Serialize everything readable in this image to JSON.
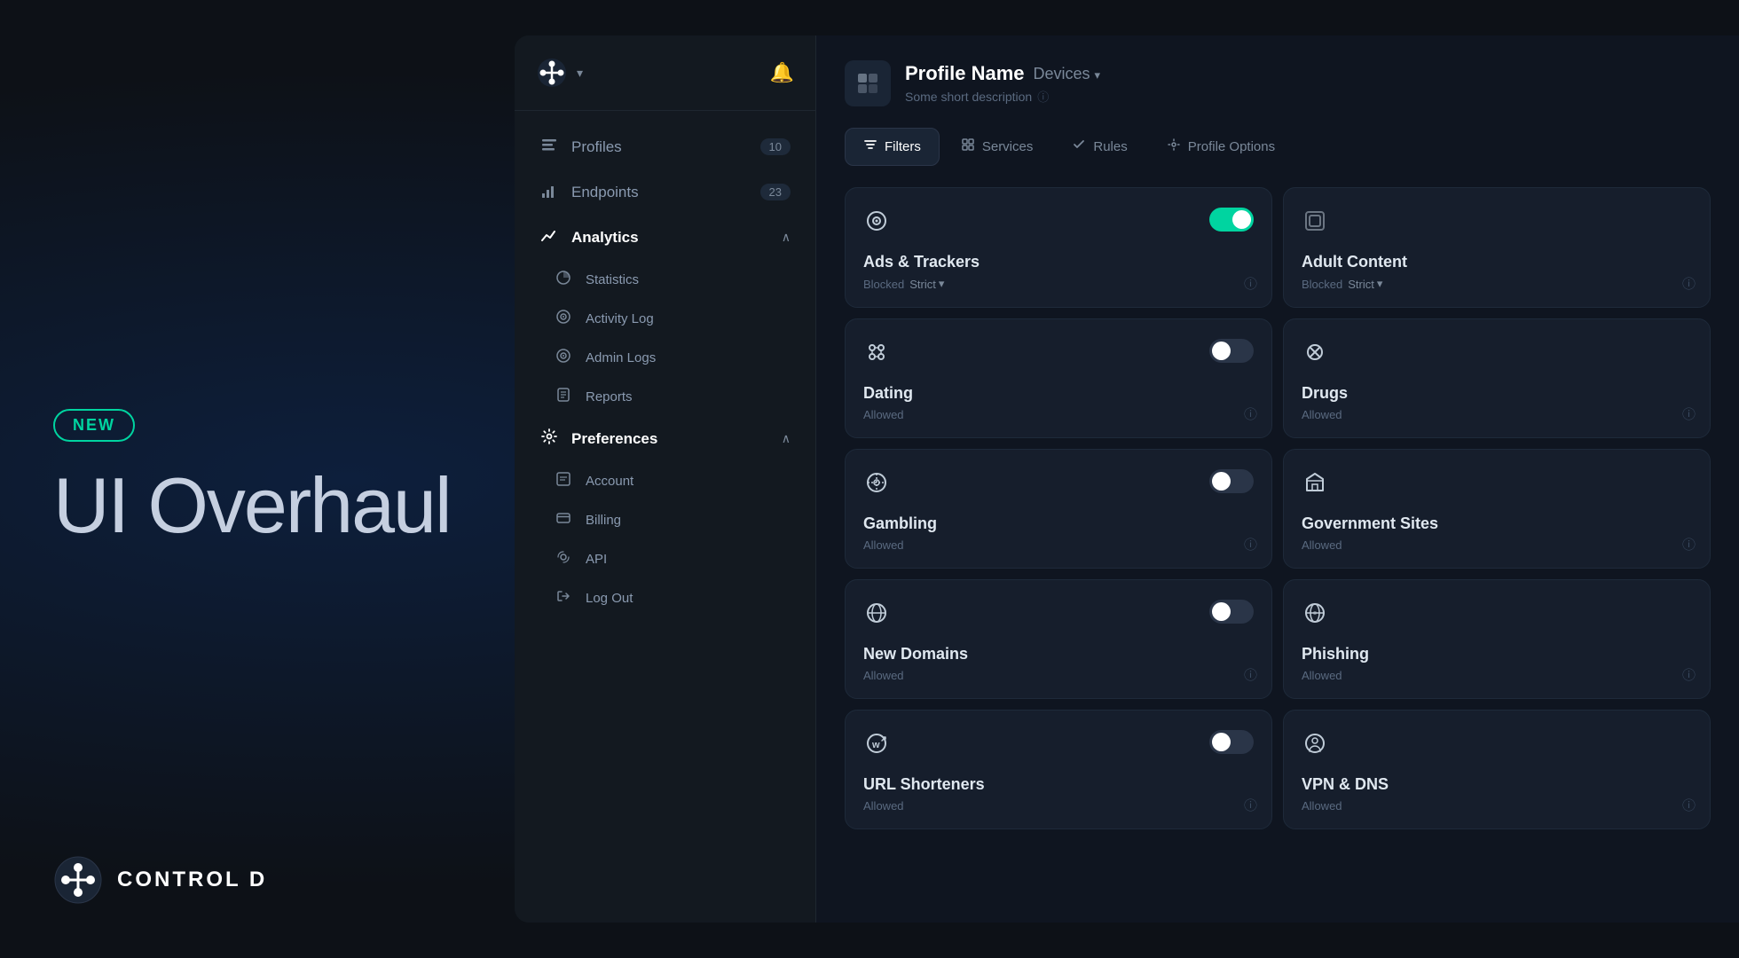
{
  "hero": {
    "badge": "NEW",
    "title": "UI Overhaul",
    "logo_text": "CONTROL D"
  },
  "sidebar": {
    "nav_items": [
      {
        "id": "profiles",
        "label": "Profiles",
        "badge": "10",
        "icon": "☰",
        "active": false
      },
      {
        "id": "endpoints",
        "label": "Endpoints",
        "badge": "23",
        "icon": "📊",
        "active": false
      },
      {
        "id": "analytics",
        "label": "Analytics",
        "chevron": "∧",
        "active": true,
        "expanded": true
      },
      {
        "id": "statistics",
        "label": "Statistics",
        "icon": "◑",
        "sub": true
      },
      {
        "id": "activity_log",
        "label": "Activity Log",
        "icon": "🔍",
        "sub": true
      },
      {
        "id": "admin_logs",
        "label": "Admin Logs",
        "icon": "🔍",
        "sub": true
      },
      {
        "id": "reports",
        "label": "Reports",
        "icon": "📋",
        "sub": true
      },
      {
        "id": "preferences",
        "label": "Preferences",
        "icon": "⚙",
        "active": true,
        "chevron": "∧",
        "expanded": true
      },
      {
        "id": "account",
        "label": "Account",
        "icon": "▤",
        "sub": true
      },
      {
        "id": "billing",
        "label": "Billing",
        "icon": "💳",
        "sub": true
      },
      {
        "id": "api",
        "label": "API",
        "icon": "⚡",
        "sub": true
      },
      {
        "id": "logout",
        "label": "Log Out",
        "icon": "⟶",
        "sub": true
      }
    ]
  },
  "profile": {
    "name": "Profile Name",
    "devices_label": "Devices",
    "description": "Some short description"
  },
  "tabs": [
    {
      "id": "filters",
      "label": "Filters",
      "icon": "filter",
      "active": true
    },
    {
      "id": "services",
      "label": "Services",
      "icon": "services",
      "active": false
    },
    {
      "id": "rules",
      "label": "Rules",
      "icon": "rules",
      "active": false
    },
    {
      "id": "profile_options",
      "label": "Profile Options",
      "icon": "options",
      "active": false
    }
  ],
  "filters": [
    {
      "id": "ads_trackers",
      "name": "Ads & Trackers",
      "status": "Blocked",
      "mode": "Strict",
      "mode_arrow": true,
      "toggle": "on",
      "icon_type": "eye"
    },
    {
      "id": "adult_content",
      "name": "Adult Content",
      "status": "Blocked",
      "mode": "Strict",
      "mode_arrow": true,
      "toggle": null,
      "icon_type": "adult"
    },
    {
      "id": "dating",
      "name": "Dating",
      "status": "Allowed",
      "mode": null,
      "toggle": "off",
      "icon_type": "dating"
    },
    {
      "id": "drugs",
      "name": "Drugs",
      "status": "Allowed",
      "mode": null,
      "toggle": null,
      "icon_type": "drugs"
    },
    {
      "id": "gambling",
      "name": "Gambling",
      "status": "Allowed",
      "mode": null,
      "toggle": "off",
      "icon_type": "gambling"
    },
    {
      "id": "government_sites",
      "name": "Government Sites",
      "status": "Allowed",
      "mode": null,
      "toggle": null,
      "icon_type": "government"
    },
    {
      "id": "new_domains",
      "name": "New Domains",
      "status": "Allowed",
      "mode": null,
      "toggle": "off",
      "icon_type": "new_domains"
    },
    {
      "id": "phishing",
      "name": "Phishing",
      "status": "Allowed",
      "mode": null,
      "toggle": null,
      "icon_type": "phishing"
    },
    {
      "id": "url_shorteners",
      "name": "URL Shorteners",
      "status": "Allowed",
      "mode": null,
      "toggle": "off",
      "icon_type": "url_shorteners"
    },
    {
      "id": "vpn_dns",
      "name": "VPN & DNS",
      "status": "Allowed",
      "mode": null,
      "toggle": null,
      "icon_type": "vpn_dns"
    }
  ]
}
